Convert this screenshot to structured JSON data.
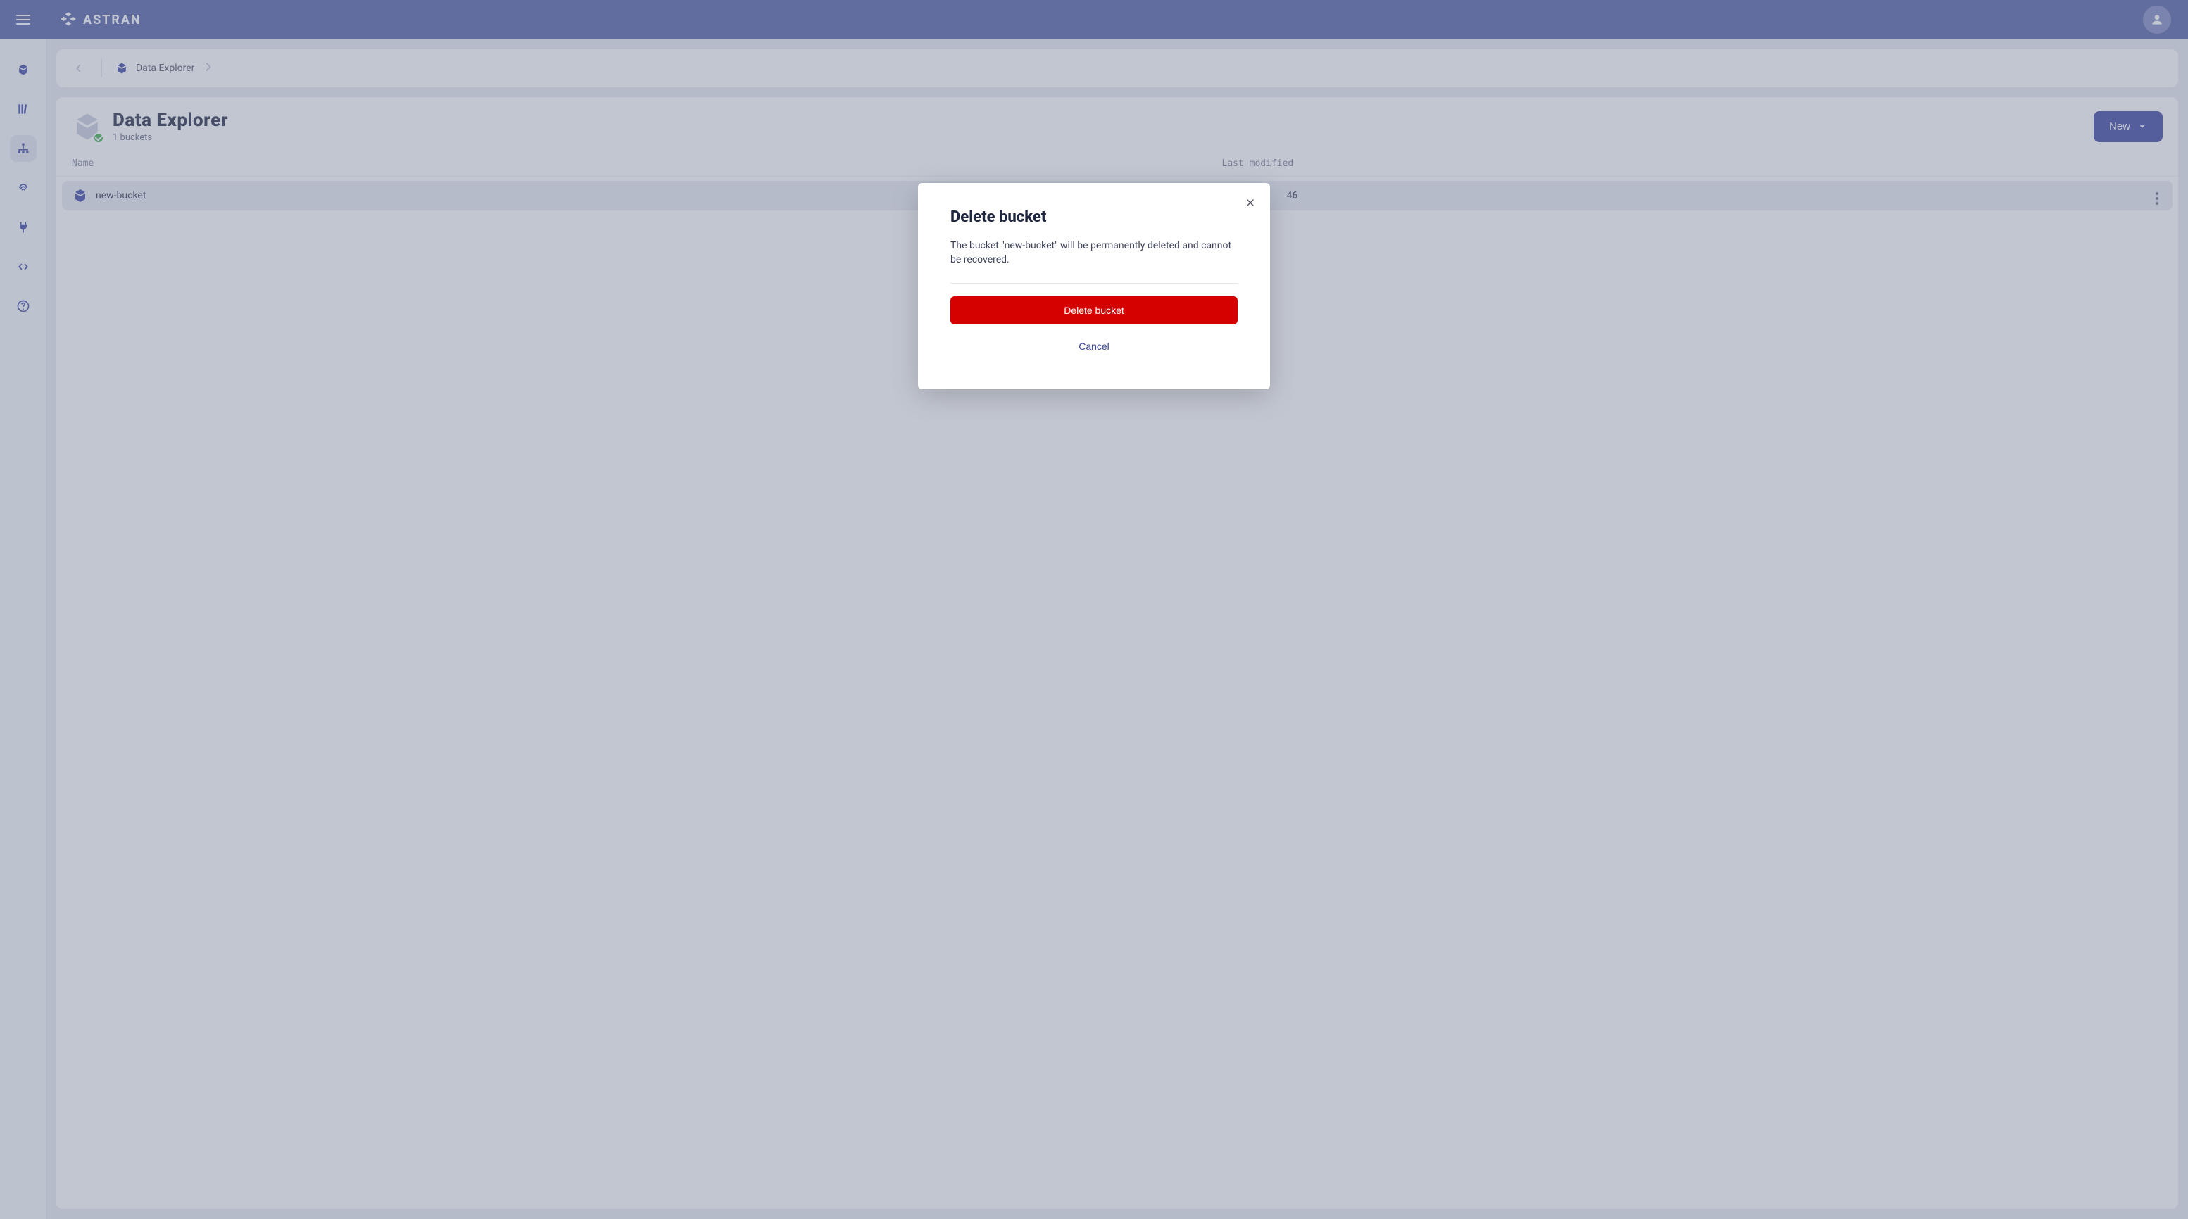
{
  "brand": {
    "name": "ASTRAN"
  },
  "breadcrumb": {
    "current": "Data Explorer"
  },
  "page": {
    "title": "Data Explorer",
    "subtitle": "1 buckets",
    "new_button": "New"
  },
  "table": {
    "columns": {
      "name": "Name",
      "modified": "Last modified"
    },
    "rows": [
      {
        "name": "new-bucket",
        "modified_suffix": "46"
      }
    ]
  },
  "modal": {
    "title": "Delete bucket",
    "body": "The bucket \"new-bucket\" will be permanently deleted and cannot be recovered.",
    "confirm": "Delete bucket",
    "cancel": "Cancel"
  }
}
